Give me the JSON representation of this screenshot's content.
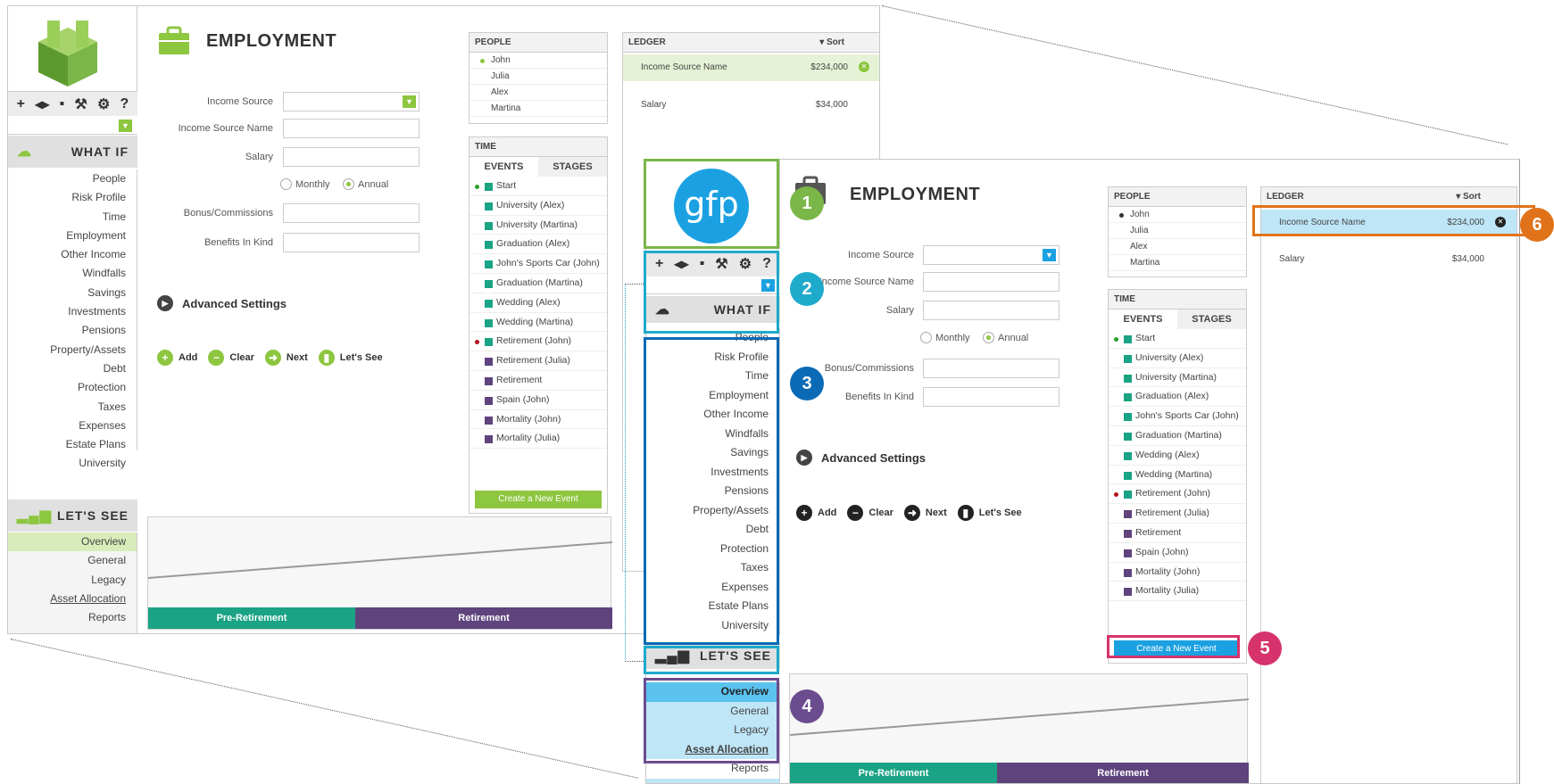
{
  "page": {
    "title": "EMPLOYMENT",
    "toolbar_icons": [
      "+",
      "◂▸",
      "▪",
      "⚒",
      "⚙",
      "?"
    ],
    "what_if": {
      "label": "WHAT IF",
      "items": [
        "People",
        "Risk Profile",
        "Time",
        "Employment",
        "Other Income",
        "Windfalls",
        "Savings",
        "Investments",
        "Pensions",
        "Property/Assets",
        "Debt",
        "Protection",
        "Taxes",
        "Expenses",
        "Estate Plans",
        "University"
      ]
    },
    "lets_see": {
      "label": "LET'S SEE",
      "items": [
        "Overview",
        "General",
        "Legacy",
        "Asset Allocation",
        "Reports"
      ]
    },
    "form": {
      "income_source_label": "Income Source",
      "income_source_name_label": "Income Source Name",
      "salary_label": "Salary",
      "monthly_label": "Monthly",
      "annual_label": "Annual",
      "bonus_label": "Bonus/Commissions",
      "benefits_label": "Benefits In Kind"
    },
    "advanced_settings": "Advanced Settings",
    "actions": {
      "add": "Add",
      "clear": "Clear",
      "next": "Next",
      "lets_see": "Let's See"
    },
    "people": {
      "header": "PEOPLE",
      "items": [
        "John",
        "Julia",
        "Alex",
        "Martina"
      ]
    },
    "time": {
      "header": "TIME",
      "tabs": [
        "EVENTS",
        "STAGES"
      ],
      "events": [
        {
          "label": "Start",
          "color": "#1aa384",
          "dot": "#2aa12a"
        },
        {
          "label": "University (Alex)",
          "color": "#1aa384"
        },
        {
          "label": "University (Martina)",
          "color": "#1aa384"
        },
        {
          "label": "Graduation (Alex)",
          "color": "#1aa384"
        },
        {
          "label": "John's Sports Car (John)",
          "color": "#1aa384"
        },
        {
          "label": "Graduation (Martina)",
          "color": "#1aa384"
        },
        {
          "label": "Wedding (Alex)",
          "color": "#1aa384"
        },
        {
          "label": "Wedding (Martina)",
          "color": "#1aa384"
        },
        {
          "label": "Retirement (John)",
          "color": "#1aa384",
          "dot": "#b5121b"
        },
        {
          "label": "Retirement (Julia)",
          "color": "#5e437d"
        },
        {
          "label": "Retirement",
          "color": "#5e437d"
        },
        {
          "label": "Spain (John)",
          "color": "#5e437d"
        },
        {
          "label": "Mortality (John)",
          "color": "#5e437d"
        },
        {
          "label": "Mortality (Julia)",
          "color": "#5e437d"
        }
      ],
      "create_button": "Create a New Event"
    },
    "ledger": {
      "header": "LEDGER",
      "sort": "Sort",
      "rows": [
        {
          "name": "Income Source Name",
          "value": "$234,000"
        },
        {
          "name": "Salary",
          "value": "$34,000"
        }
      ]
    },
    "chart": {
      "bands": [
        "Pre-Retirement",
        "Retirement"
      ]
    }
  },
  "front_logo": "gfp",
  "callouts": [
    "1",
    "2",
    "3",
    "4",
    "5",
    "6"
  ],
  "colors": {
    "green": "#8dc63f",
    "blue_accent": "#1ba1e2",
    "teal": "#1aa384",
    "purple": "#5e437d",
    "callout1": "#7ab648",
    "callout2": "#1eaacb",
    "callout3": "#0a6ab5",
    "callout4": "#6b4c8f",
    "callout5": "#d6336c",
    "callout6": "#e0731a"
  }
}
